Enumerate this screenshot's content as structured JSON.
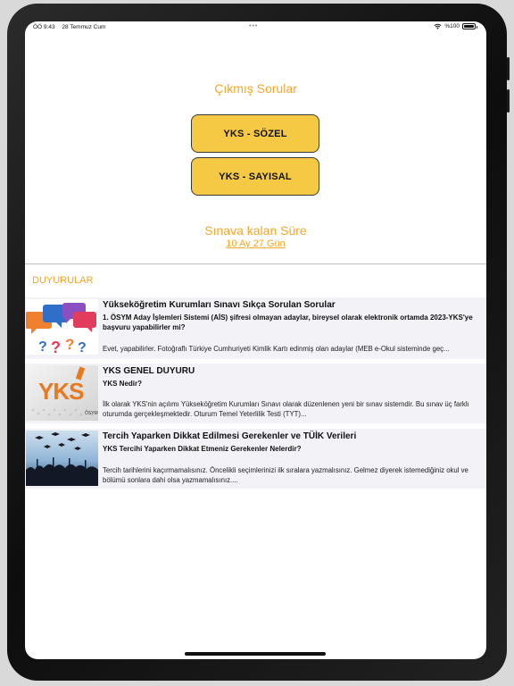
{
  "status_bar": {
    "time": "ÖÖ 9:43",
    "date": "28 Temmuz Cum",
    "dots": "•••",
    "battery": "%100",
    "icons": [
      "wifi-icon",
      "battery-icon"
    ]
  },
  "main": {
    "title": "Çıkmış Sorular",
    "buttons": [
      {
        "label": "YKS - SÖZEL"
      },
      {
        "label": "YKS - SAYISAL"
      }
    ],
    "countdown_label": "Sınava kalan Süre",
    "countdown_value": "10 Ay 27 Gün"
  },
  "announcements": {
    "header": "DUYURULAR",
    "items": [
      {
        "title": "Yükseköğretim Kurumları Sınavı Sıkça Sorulan Sorular",
        "subtitle": "1.  ÖSYM Aday İşlemleri Sistemi (AİS) şifresi olmayan adaylar, bireysel olarak elektronik ortamda 2023-YKS'ye başvuru yapabilirler mi?",
        "body": "Evet, yapabilirler. Fotoğraflı Türkiye Cumhuriyeti Kimlik Kartı edinmiş olan adaylar (MEB e-Okul sisteminde geç...",
        "thumb_icon": "speech-bubbles-question-icon"
      },
      {
        "title": "YKS GENEL DUYURU",
        "subtitle": "YKS Nedir?",
        "body": "İlk olarak YKS'nin açılımı Yükseköğretim Kurumları Sınavı olarak düzenlenen yeni bir sınav sistemdir. Bu sınav üç farklı oturumda gerçekleşmektedir.  Oturum Temel Yeterlilik Testi (TYT)...",
        "thumb_text": "YKS",
        "thumb_brand": "ÖSYM",
        "thumb_icon": "yks-logo-icon"
      },
      {
        "title": "Tercih Yaparken Dikkat Edilmesi Gerekenler ve TÜİK Verileri",
        "subtitle": "YKS Tercihi Yaparken Dikkat Etmeniz Gerekenler Nelerdir?",
        "body": "Tercih tarihlerini kaçırmamalısınız.  Öncelikli seçimlerinizi ilk sıralara yazmalısınız.  Gelmez diyerek istemediğiniz okul ve bölümü sonlara dahi olsa yazmamalısınız....",
        "thumb_icon": "graduation-caps-icon"
      }
    ]
  },
  "colors": {
    "accent": "#f4a72a",
    "button_fill": "#f6c945",
    "card_bg": "#f2f2f7"
  }
}
